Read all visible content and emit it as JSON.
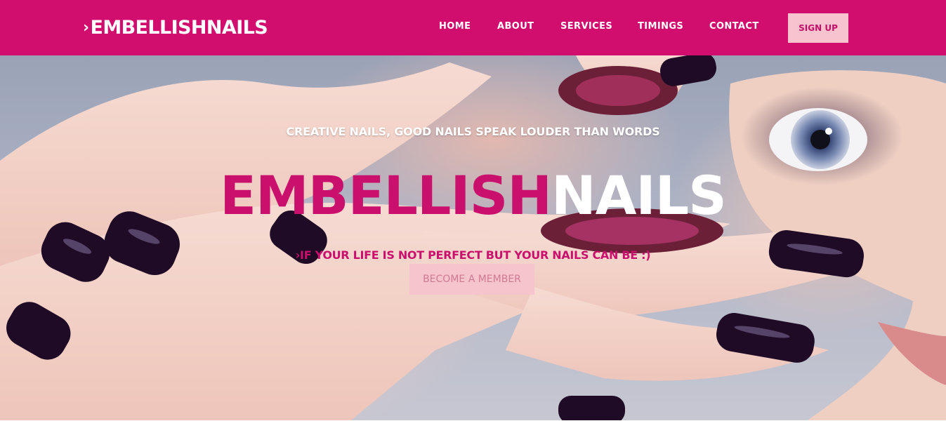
{
  "brand": {
    "chevron": "›",
    "name": "EMBELLISHNAILS"
  },
  "nav": {
    "links": [
      {
        "label": "HOME"
      },
      {
        "label": "ABOUT"
      },
      {
        "label": "SERVICES"
      },
      {
        "label": "TIMINGS"
      },
      {
        "label": "CONTACT"
      }
    ],
    "signup_label": "SIGN UP"
  },
  "hero": {
    "tagline": "CREATIVE NAILS, GOOD NAILS SPEAK LOUDER THAN WORDS",
    "title_part1": "EMBELLISH",
    "title_part2": "NAILS",
    "subtitle": "›IF YOUR LIFE IS NOT PERFECT BUT YOUR NAILS CAN BE :)",
    "cta_label": "BECOME A MEMBER"
  },
  "colors": {
    "brand_pink": "#d10d6e",
    "accent_pink": "#c9106c",
    "light_pink_button": "#f7c3ce",
    "nail_polish": "#1f0b26"
  }
}
